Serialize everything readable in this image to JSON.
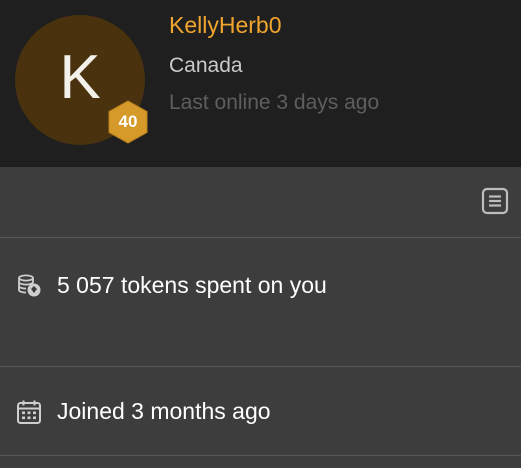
{
  "profile": {
    "avatar_letter": "K",
    "level": "40",
    "username": "KellyHerb0",
    "country": "Canada",
    "last_online": "Last online 3 days ago"
  },
  "stats": {
    "tokens_spent": "5 057 tokens spent on you",
    "joined": "Joined 3 months ago"
  },
  "icons": {
    "notes": "notes-icon",
    "tokens": "coins-icon",
    "joined": "calendar-icon",
    "level": "hexagon-badge-icon"
  },
  "colors": {
    "username": "#f2a52e",
    "avatar_bg": "#4b320e",
    "badge": "#d69a2a",
    "header_bg": "#1f1f1f",
    "panel_bg": "#3d3d3d"
  }
}
